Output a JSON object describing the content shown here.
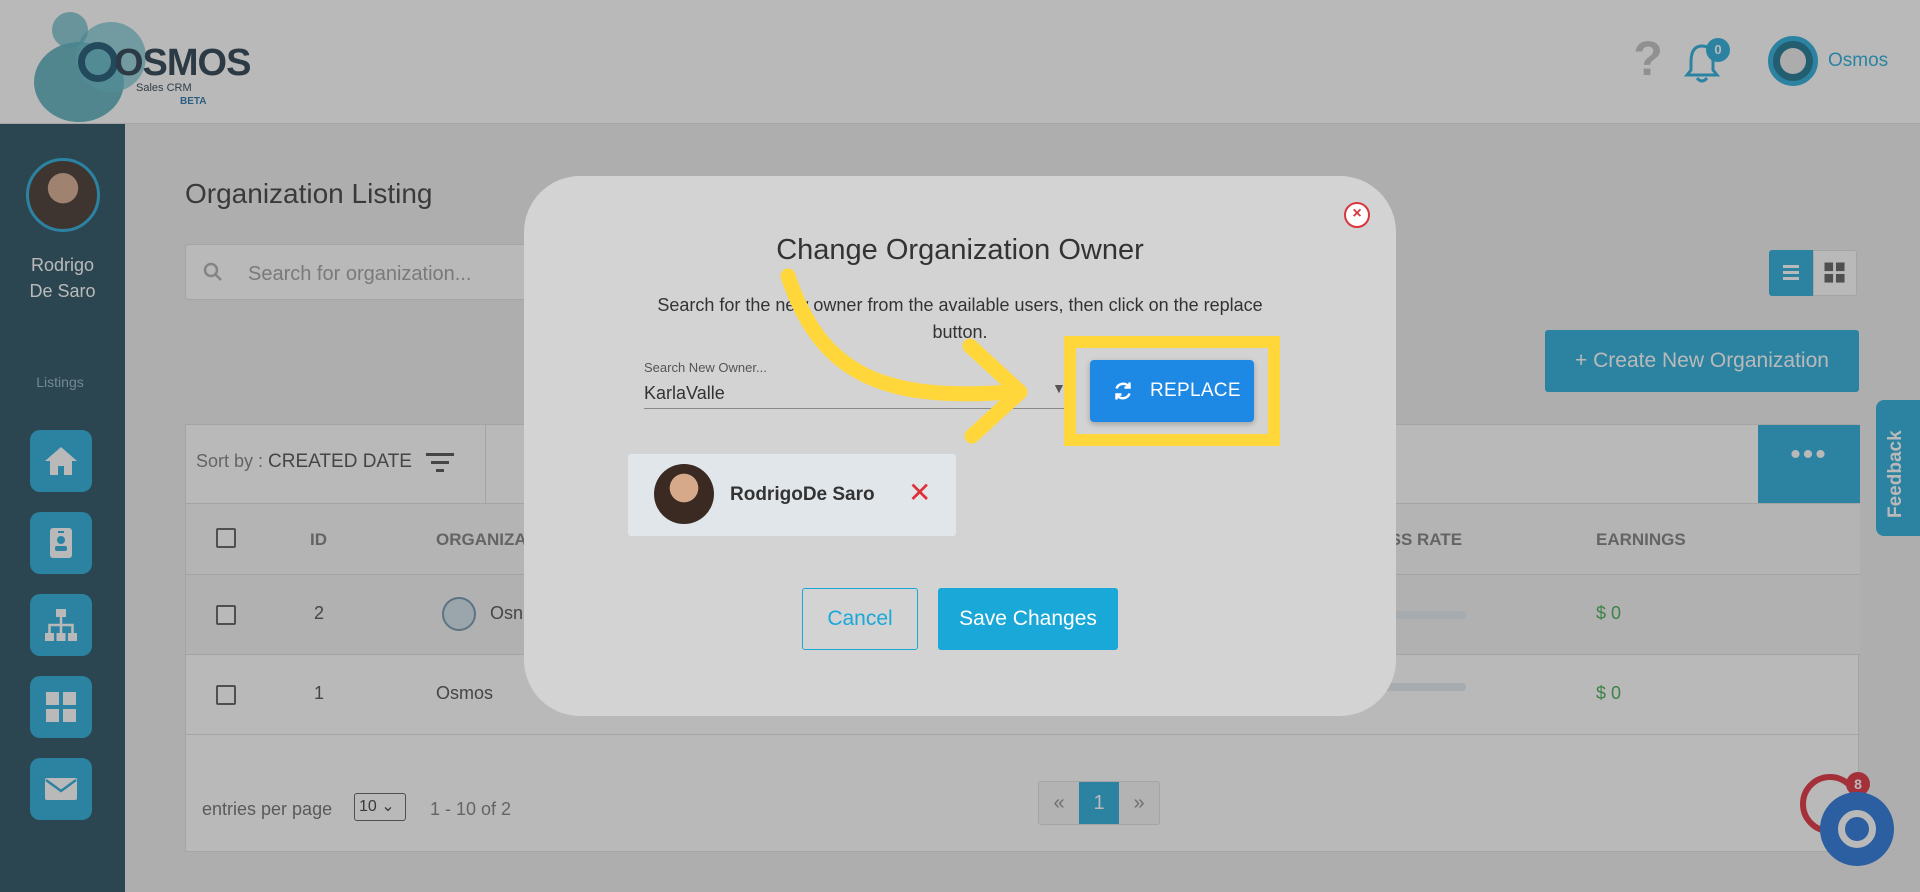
{
  "header": {
    "logo_text": "OSMOS",
    "logo_sub": "Sales CRM",
    "logo_beta": "BETA",
    "help_icon": "?",
    "notification_count": "0",
    "user_name": "Osmos"
  },
  "sidebar": {
    "profile_first": "Rodrigo",
    "profile_last": "De Saro",
    "section_label": "Listings",
    "items": [
      {
        "icon": "home-icon"
      },
      {
        "icon": "contact-card-icon"
      },
      {
        "icon": "organization-tree-icon"
      },
      {
        "icon": "grid-icon"
      },
      {
        "icon": "mail-icon"
      }
    ]
  },
  "main": {
    "title": "Organization Listing",
    "search_placeholder": "Search for organization...",
    "create_button": "+ Create New Organization",
    "sort_label": "Sort by : ",
    "sort_value": "CREATED DATE",
    "more_button": "•••",
    "columns": [
      "ID",
      "ORGANIZA",
      "CESS RATE",
      "EARNINGS"
    ],
    "rows": [
      {
        "id": "2",
        "name": "Osn",
        "rate": "",
        "earnings": "$ 0"
      },
      {
        "id": "1",
        "name": "Osmos",
        "rate": "%",
        "earnings": "$ 0"
      }
    ],
    "entries_label": "entries per page",
    "per_page": "10",
    "range": "1 - 10 of 2",
    "pager": {
      "prev": "«",
      "current": "1",
      "next": "»"
    }
  },
  "feedback": "Feedback",
  "chat_badge": "8",
  "modal": {
    "title": "Change Organization Owner",
    "description": "Search for the new owner from the available users, then click on the replace button.",
    "owner_label": "Search New Owner...",
    "owner_value": "KarlaValle",
    "replace_button": "REPLACE",
    "selected_owner": "RodrigoDe Saro",
    "cancel_button": "Cancel",
    "save_button": "Save Changes"
  },
  "colors": {
    "accent": "#1aa8d8",
    "sidebar": "#1a4558",
    "replace": "#1e88e5",
    "highlight": "#ffd73a",
    "danger": "#e0313a",
    "earnings": "#3aa64a"
  }
}
